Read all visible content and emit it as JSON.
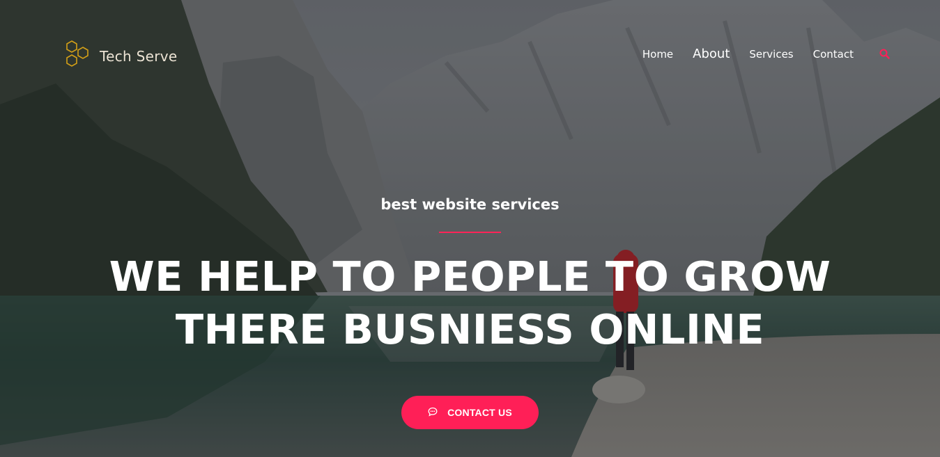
{
  "brand": {
    "name": "Tech Serve",
    "icon": "hexagon-logo-icon",
    "color": "#d4a017"
  },
  "nav": {
    "items": [
      {
        "label": "Home"
      },
      {
        "label": "About"
      },
      {
        "label": "Services"
      },
      {
        "label": "Contact"
      }
    ],
    "search_icon": "search-icon",
    "accent": "#ff1f57"
  },
  "hero": {
    "subtitle": "best website services",
    "headline_line1": "WE HELP TO PEOPLE TO GROW",
    "headline_line2": "THERE BUSNIESS ONLINE",
    "cta_label": "CONTACT US",
    "cta_icon": "chat-bubble-icon"
  }
}
